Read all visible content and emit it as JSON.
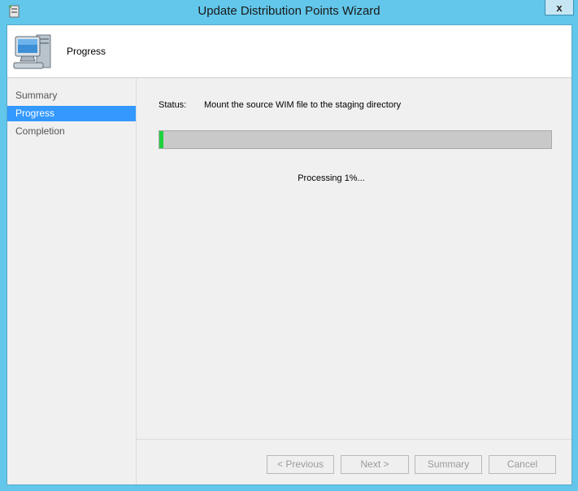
{
  "window": {
    "title": "Update Distribution Points Wizard",
    "close_label": "x"
  },
  "header": {
    "title": "Progress",
    "icon": "computer-icon"
  },
  "nav": {
    "items": [
      {
        "label": "Summary",
        "active": false
      },
      {
        "label": "Progress",
        "active": true
      },
      {
        "label": "Completion",
        "active": false
      }
    ]
  },
  "main": {
    "status_label": "Status:",
    "status_text": "Mount the source WIM file to the staging directory",
    "progress_percent": 1,
    "processing_text": "Processing 1%..."
  },
  "buttons": {
    "previous": "< Previous",
    "next": "Next >",
    "summary": "Summary",
    "cancel": "Cancel"
  },
  "colors": {
    "accent": "#3399ff",
    "progress": "#1fd13d",
    "frame": "#62c7ea"
  }
}
